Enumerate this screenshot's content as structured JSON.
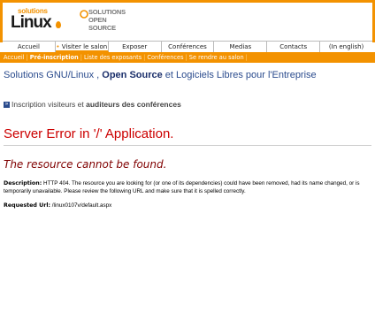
{
  "header": {
    "logo1_small": "solutions",
    "logo1_big": "Linux",
    "logo2_lines": [
      "SOLUTIONS",
      "OPEN",
      "SOURCE"
    ]
  },
  "nav": {
    "items": [
      {
        "label": "Accueil"
      },
      {
        "label": "Visiter le salon",
        "bullet": "•"
      },
      {
        "label": "Exposer"
      },
      {
        "label": "Conférences"
      },
      {
        "label": "Medias"
      },
      {
        "label": "Contacts"
      },
      {
        "label": "(In english)"
      }
    ]
  },
  "subnav": {
    "items": [
      "Accueil",
      "Pré-inscription",
      "Liste des exposants",
      "Conférences",
      "Se rendre au salon"
    ],
    "separator": "|"
  },
  "tagline": {
    "part1": "Solutions GNU/Linux , ",
    "bold": "Open Source",
    "part2": " et Logiciels Libres pour l'Entreprise"
  },
  "inscription": {
    "arrow": "»",
    "part1": "Inscription visiteurs et ",
    "bold": "auditeurs des conférences"
  },
  "error": {
    "title": "Server Error in '/' Application.",
    "subtitle": "The resource cannot be found.",
    "description_label": "Description:",
    "description_text": " HTTP 404. The resource you are looking for (or one of its dependencies) could have been removed, had its name changed, or is temporarily unavailable.  Please review the following URL and make sure that it is spelled correctly.",
    "url_label": "Requested Url:",
    "url_value": " /linux0107v/default.aspx"
  },
  "colors": {
    "brand_orange": "#f39200",
    "tagline_blue": "#2a4b8d",
    "error_red": "#cc0000",
    "error_sub": "#800000"
  }
}
